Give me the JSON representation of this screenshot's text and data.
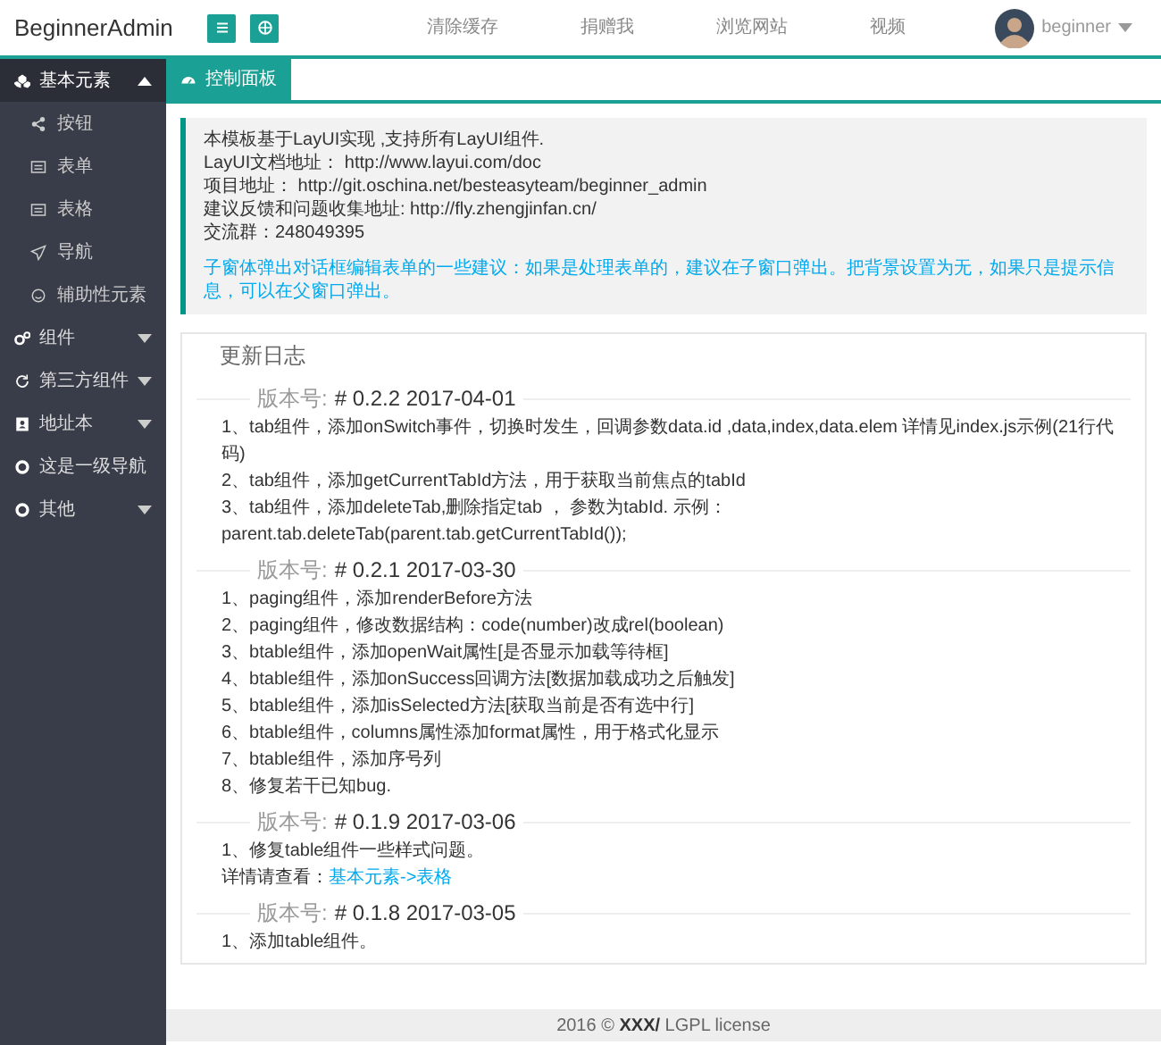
{
  "header": {
    "logo": "BeginnerAdmin",
    "tool_buttons": [
      {
        "kind": "menu"
      },
      {
        "kind": "globe"
      }
    ],
    "links": [
      "清除缓存",
      "捐赠我",
      "浏览网站",
      "视频"
    ],
    "user": {
      "name": "beginner"
    }
  },
  "sidebar": {
    "items": [
      {
        "label": "基本元素",
        "expanded": true,
        "has_children": true,
        "children": [
          {
            "label": "按钮"
          },
          {
            "label": "表单"
          },
          {
            "label": "表格"
          },
          {
            "label": "导航"
          },
          {
            "label": "辅助性元素"
          }
        ]
      },
      {
        "label": "组件",
        "expanded": false,
        "has_children": true
      },
      {
        "label": "第三方组件",
        "expanded": false,
        "has_children": true
      },
      {
        "label": "地址本",
        "expanded": false,
        "has_children": true
      },
      {
        "label": "这是一级导航",
        "expanded": false,
        "has_children": false
      },
      {
        "label": "其他",
        "expanded": false,
        "has_children": true
      }
    ]
  },
  "tabs": [
    {
      "label": "控制面板",
      "selected": true
    }
  ],
  "notice": {
    "lines": [
      "本模板基于LayUI实现 ,支持所有LayUI组件.",
      "LayUI文档地址： http://www.layui.com/doc",
      "项目地址： http://git.oschina.net/besteasyteam/beginner_admin",
      "建议反馈和问题收集地址: http://fly.zhengjinfan.cn/",
      "交流群：248049395"
    ],
    "tip": "子窗体弹出对话框编辑表单的一些建议：如果是处理表单的，建议在子窗口弹出。把背景设置为无，如果只是提示信息，可以在父窗口弹出。"
  },
  "changelog": {
    "title": "更新日志",
    "versions": [
      {
        "label": "版本号:",
        "version": "# 0.2.2 2017-04-01",
        "items": [
          {
            "text": "1、tab组件，添加onSwitch事件，切换时发生，回调参数data.id ,data,index,data.elem 详情见index.js示例(21行代码)"
          },
          {
            "text": "2、tab组件，添加getCurrentTabId方法，用于获取当前焦点的tabId"
          },
          {
            "text": "3、tab组件，添加deleteTab,删除指定tab ， 参数为tabId. 示例：parent.tab.deleteTab(parent.tab.getCurrentTabId());"
          }
        ]
      },
      {
        "label": "版本号:",
        "version": "# 0.2.1 2017-03-30",
        "items": [
          {
            "text": "1、paging组件，添加renderBefore方法"
          },
          {
            "text": "2、paging组件，修改数据结构：code(number)改成rel(boolean)"
          },
          {
            "text": "3、btable组件，添加openWait属性[是否显示加载等待框]"
          },
          {
            "text": "4、btable组件，添加onSuccess回调方法[数据加载成功之后触发]"
          },
          {
            "text": "5、btable组件，添加isSelected方法[获取当前是否有选中行]"
          },
          {
            "text": "6、btable组件，columns属性添加format属性，用于格式化显示"
          },
          {
            "text": "7、btable组件，添加序号列"
          },
          {
            "text": "8、修复若干已知bug."
          }
        ]
      },
      {
        "label": "版本号:",
        "version": "# 0.1.9 2017-03-06",
        "items": [
          {
            "text": "1、修复table组件一些样式问题。"
          },
          {
            "text": "详情请查看：",
            "link": "基本元素->表格"
          }
        ]
      },
      {
        "label": "版本号:",
        "version": "# 0.1.8 2017-03-05",
        "items": [
          {
            "text": "1、添加table组件。"
          }
        ]
      }
    ]
  },
  "footer": {
    "text": "2016 © ",
    "link": "XXX/",
    "license": " LGPL license"
  }
}
